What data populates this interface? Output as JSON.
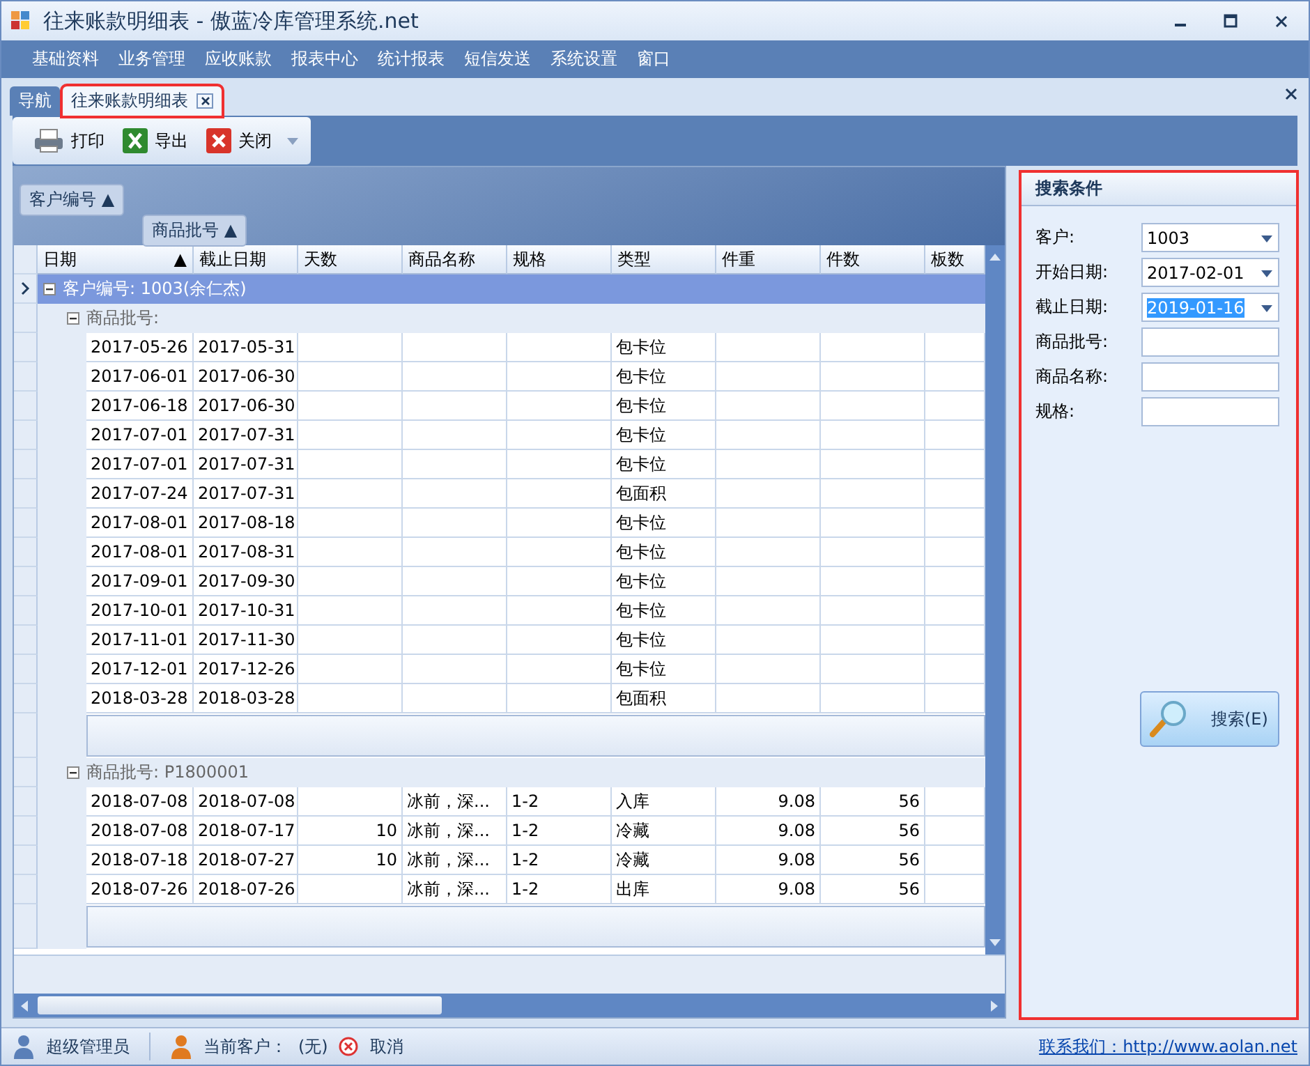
{
  "window": {
    "title": "往来账款明细表 - 傲蓝冷库管理系统.net"
  },
  "menu": [
    "基础资料",
    "业务管理",
    "应收账款",
    "报表中心",
    "统计报表",
    "短信发送",
    "系统设置",
    "窗口"
  ],
  "tabs": [
    {
      "label": "导航",
      "selected": false,
      "closable": false,
      "highlighted": false
    },
    {
      "label": "往来账款明细表",
      "selected": true,
      "closable": true,
      "highlighted": true
    }
  ],
  "toolbar": [
    {
      "label": "打印",
      "kind": "print"
    },
    {
      "label": "导出",
      "kind": "excel"
    },
    {
      "label": "关闭",
      "kind": "close"
    }
  ],
  "group_panel": [
    {
      "label": "客户编号",
      "sort": "▲"
    },
    {
      "label": "商品批号",
      "sort": "▲"
    }
  ],
  "table": {
    "columns": [
      {
        "label": "日期",
        "sort": "▲"
      },
      {
        "label": "截止日期"
      },
      {
        "label": "天数"
      },
      {
        "label": "商品名称"
      },
      {
        "label": "规格"
      },
      {
        "label": "类型"
      },
      {
        "label": "件重"
      },
      {
        "label": "件数"
      },
      {
        "label": "板数"
      }
    ],
    "group": {
      "label": "客户编号: 1003(余仁杰)",
      "selected": true,
      "expanded": true,
      "children": [
        {
          "label": "商品批号:",
          "expanded": true,
          "rows": [
            {
              "date": "2017-05-26",
              "end_date": "2017-05-31",
              "type": "包卡位"
            },
            {
              "date": "2017-06-01",
              "end_date": "2017-06-30",
              "type": "包卡位"
            },
            {
              "date": "2017-06-18",
              "end_date": "2017-06-30",
              "type": "包卡位"
            },
            {
              "date": "2017-07-01",
              "end_date": "2017-07-31",
              "type": "包卡位"
            },
            {
              "date": "2017-07-01",
              "end_date": "2017-07-31",
              "type": "包卡位"
            },
            {
              "date": "2017-07-24",
              "end_date": "2017-07-31",
              "type": "包面积"
            },
            {
              "date": "2017-08-01",
              "end_date": "2017-08-18",
              "type": "包卡位"
            },
            {
              "date": "2017-08-01",
              "end_date": "2017-08-31",
              "type": "包卡位"
            },
            {
              "date": "2017-09-01",
              "end_date": "2017-09-30",
              "type": "包卡位"
            },
            {
              "date": "2017-10-01",
              "end_date": "2017-10-31",
              "type": "包卡位"
            },
            {
              "date": "2017-11-01",
              "end_date": "2017-11-30",
              "type": "包卡位"
            },
            {
              "date": "2017-12-01",
              "end_date": "2017-12-26",
              "type": "包卡位"
            },
            {
              "date": "2018-03-28",
              "end_date": "2018-03-28",
              "type": "包面积"
            }
          ]
        },
        {
          "label": "商品批号: P1800001",
          "expanded": true,
          "rows": [
            {
              "date": "2018-07-08",
              "end_date": "2018-07-08",
              "name": "冰前，深...",
              "spec": "1-2",
              "type": "入库",
              "weight": "9.08",
              "count": "56"
            },
            {
              "date": "2018-07-08",
              "end_date": "2018-07-17",
              "days": "10",
              "name": "冰前，深...",
              "spec": "1-2",
              "type": "冷藏",
              "weight": "9.08",
              "count": "56"
            },
            {
              "date": "2018-07-18",
              "end_date": "2018-07-27",
              "days": "10",
              "name": "冰前，深...",
              "spec": "1-2",
              "type": "冷藏",
              "weight": "9.08",
              "count": "56"
            },
            {
              "date": "2018-07-26",
              "end_date": "2018-07-26",
              "name": "冰前，深...",
              "spec": "1-2",
              "type": "出库",
              "weight": "9.08",
              "count": "56"
            }
          ]
        }
      ]
    }
  },
  "search": {
    "title": "搜索条件",
    "highlighted": true,
    "fields": [
      {
        "label": "客户:",
        "value": "1003",
        "kind": "dropdown",
        "selected_text": false
      },
      {
        "label": "开始日期:",
        "value": "2017-02-01",
        "kind": "dropdown",
        "selected_text": false
      },
      {
        "label": "截止日期:",
        "value": "2019-01-16",
        "kind": "dropdown",
        "selected_text": true
      },
      {
        "label": "商品批号:",
        "kind": "text"
      },
      {
        "label": "商品名称:",
        "kind": "text"
      },
      {
        "label": "规格:",
        "kind": "text"
      }
    ],
    "button": "搜索(E)"
  },
  "status_bar": {
    "user": "超级管理员",
    "customer_label": "当前客户：",
    "customer": "(无)",
    "cancel": "取消",
    "link": "联系我们：http://www.aolan.net"
  }
}
